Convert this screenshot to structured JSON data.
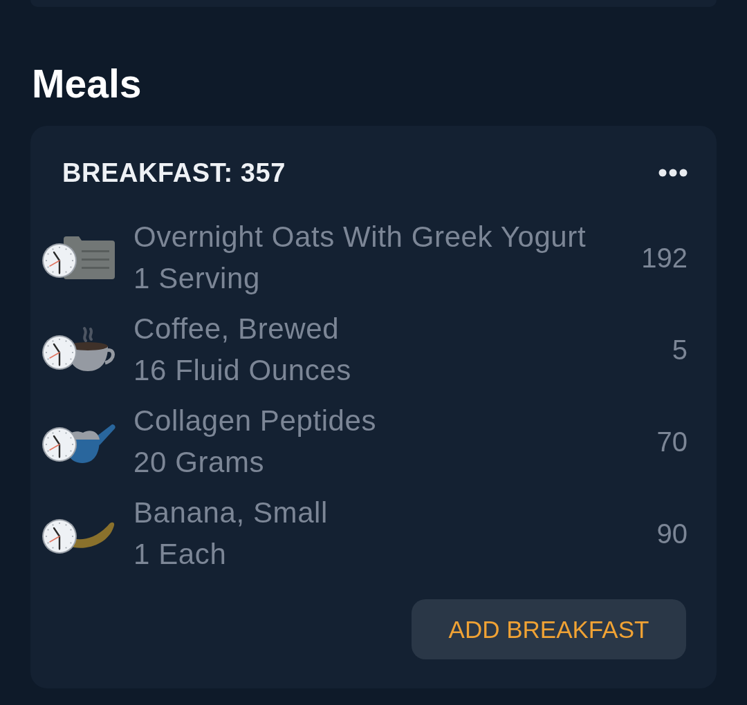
{
  "section_title": "Meals",
  "meal": {
    "title": "BREAKFAST: 357",
    "items": [
      {
        "kind": "document",
        "name": "Overnight Oats With Greek Yogurt",
        "serving": "1 Serving",
        "calories": "192",
        "scheduled": true
      },
      {
        "kind": "cup",
        "name": "Coffee, Brewed",
        "serving": "16 Fluid Ounces",
        "calories": "5",
        "scheduled": true
      },
      {
        "kind": "scoop",
        "name": "Collagen Peptides",
        "serving": "20 Grams",
        "calories": "70",
        "scheduled": true
      },
      {
        "kind": "banana",
        "name": "Banana, Small",
        "serving": "1 Each",
        "calories": "90",
        "scheduled": true
      }
    ],
    "add_button": "ADD BREAKFAST"
  }
}
